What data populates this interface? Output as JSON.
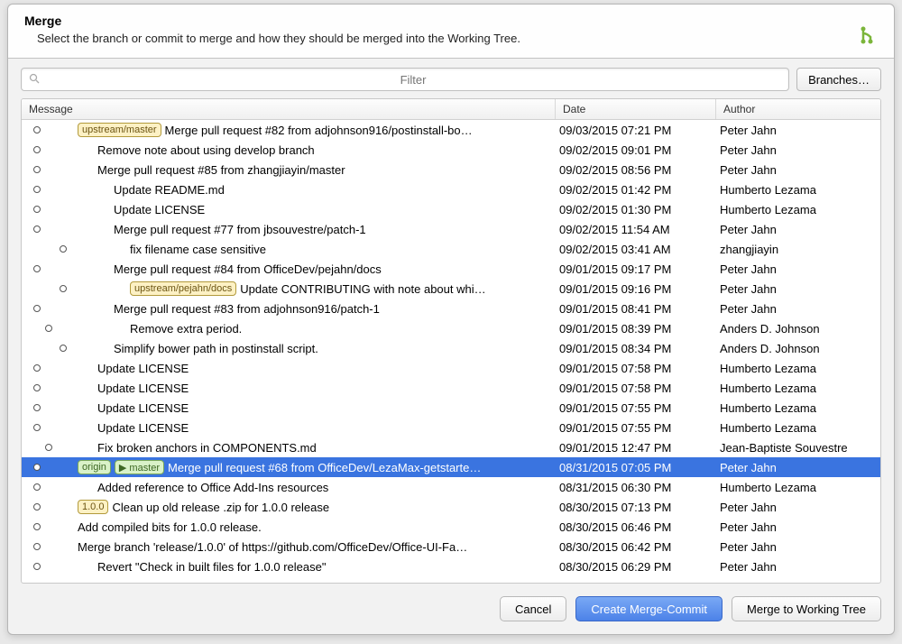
{
  "header": {
    "title": "Merge",
    "subtitle": "Select the branch or commit to merge and how they should be merged into the Working Tree."
  },
  "toolbar": {
    "filter_placeholder": "Filter",
    "branches_label": "Branches…"
  },
  "columns": {
    "message": "Message",
    "date": "Date",
    "author": "Author"
  },
  "commits": [
    {
      "badges": [
        {
          "text": "upstream/master",
          "style": "yellow"
        }
      ],
      "indent": 0,
      "message": "Merge pull request #82 from adjohnson916/postinstall-bo…",
      "date": "09/03/2015 07:21 PM",
      "author": "Peter Jahn",
      "dotx": 9
    },
    {
      "badges": [],
      "indent": 1,
      "message": "Remove note about using develop branch",
      "date": "09/02/2015 09:01 PM",
      "author": "Peter Jahn",
      "dotx": 9
    },
    {
      "badges": [],
      "indent": 1,
      "message": "Merge pull request #85 from zhangjiayin/master",
      "date": "09/02/2015 08:56 PM",
      "author": "Peter Jahn",
      "dotx": 9
    },
    {
      "badges": [],
      "indent": 2,
      "message": "Update README.md",
      "date": "09/02/2015 01:42 PM",
      "author": "Humberto Lezama",
      "dotx": 9
    },
    {
      "badges": [],
      "indent": 2,
      "message": "Update LICENSE",
      "date": "09/02/2015 01:30 PM",
      "author": "Humberto Lezama",
      "dotx": 9
    },
    {
      "badges": [],
      "indent": 2,
      "message": "Merge pull request #77 from jbsouvestre/patch-1",
      "date": "09/02/2015 11:54 AM",
      "author": "Peter Jahn",
      "dotx": 9
    },
    {
      "badges": [],
      "indent": 3,
      "message": "fix filename case  sensitive",
      "date": "09/02/2015 03:41 AM",
      "author": "zhangjiayin",
      "dotx": 38
    },
    {
      "badges": [],
      "indent": 2,
      "message": "Merge pull request #84 from OfficeDev/pejahn/docs",
      "date": "09/01/2015 09:17 PM",
      "author": "Peter Jahn",
      "dotx": 9
    },
    {
      "badges": [
        {
          "text": "upstream/pejahn/docs",
          "style": "yellow"
        }
      ],
      "indent": 3,
      "message": "Update CONTRIBUTING with note about whi…",
      "date": "09/01/2015 09:16 PM",
      "author": "Peter Jahn",
      "dotx": 38
    },
    {
      "badges": [],
      "indent": 2,
      "message": "Merge pull request #83 from adjohnson916/patch-1",
      "date": "09/01/2015 08:41 PM",
      "author": "Peter Jahn",
      "dotx": 9
    },
    {
      "badges": [],
      "indent": 3,
      "message": "Remove extra period.",
      "date": "09/01/2015 08:39 PM",
      "author": "Anders D. Johnson",
      "dotx": 22
    },
    {
      "badges": [],
      "indent": 2,
      "message": "Simplify bower path in postinstall script.",
      "date": "09/01/2015 08:34 PM",
      "author": "Anders D. Johnson",
      "dotx": 38
    },
    {
      "badges": [],
      "indent": 1,
      "message": "Update LICENSE",
      "date": "09/01/2015 07:58 PM",
      "author": "Humberto Lezama",
      "dotx": 9
    },
    {
      "badges": [],
      "indent": 1,
      "message": "Update LICENSE",
      "date": "09/01/2015 07:58 PM",
      "author": "Humberto Lezama",
      "dotx": 9
    },
    {
      "badges": [],
      "indent": 1,
      "message": "Update LICENSE",
      "date": "09/01/2015 07:55 PM",
      "author": "Humberto Lezama",
      "dotx": 9
    },
    {
      "badges": [],
      "indent": 1,
      "message": "Update LICENSE",
      "date": "09/01/2015 07:55 PM",
      "author": "Humberto Lezama",
      "dotx": 9
    },
    {
      "badges": [],
      "indent": 1,
      "message": "Fix broken anchors in COMPONENTS.md",
      "date": "09/01/2015 12:47 PM",
      "author": "Jean-Baptiste Souvestre",
      "dotx": 22
    },
    {
      "badges": [
        {
          "text": "origin",
          "style": "green"
        },
        {
          "text": "▶ master",
          "style": "green",
          "tri": true
        }
      ],
      "indent": 0,
      "message": "Merge pull request #68 from OfficeDev/LezaMax-getstarte…",
      "date": "08/31/2015 07:05 PM",
      "author": "Peter Jahn",
      "selected": true,
      "dotx": 9
    },
    {
      "badges": [],
      "indent": 1,
      "message": "Added reference to Office Add-Ins resources",
      "date": "08/31/2015 06:30 PM",
      "author": "Humberto Lezama",
      "dotx": 9
    },
    {
      "badges": [
        {
          "text": "1.0.0",
          "style": "yellow"
        }
      ],
      "indent": 0,
      "message": "Clean up old release .zip for 1.0.0 release",
      "date": "08/30/2015 07:13 PM",
      "author": "Peter Jahn",
      "dotx": 9
    },
    {
      "badges": [],
      "indent": 0,
      "message": "Add compiled bits for 1.0.0 release.",
      "date": "08/30/2015 06:46 PM",
      "author": "Peter Jahn",
      "dotx": 9
    },
    {
      "badges": [],
      "indent": 0,
      "message": "Merge branch 'release/1.0.0' of https://github.com/OfficeDev/Office-UI-Fa…",
      "date": "08/30/2015 06:42 PM",
      "author": "Peter Jahn",
      "dotx": 9
    },
    {
      "badges": [],
      "indent": 1,
      "message": "Revert \"Check in built files for 1.0.0 release\"",
      "date": "08/30/2015 06:29 PM",
      "author": "Peter Jahn",
      "dotx": 9
    }
  ],
  "footer": {
    "cancel": "Cancel",
    "create": "Create Merge-Commit",
    "merge": "Merge to Working Tree"
  }
}
